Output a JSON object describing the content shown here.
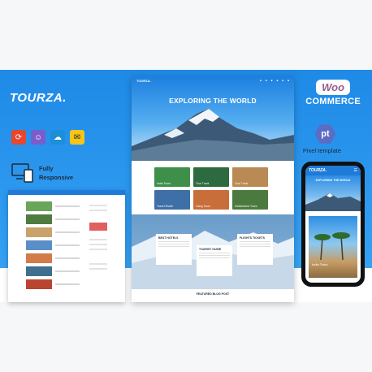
{
  "brand": {
    "name": "TOURZA."
  },
  "features": {
    "responsive_line1": "Fully",
    "responsive_line2": "Responsive"
  },
  "woo": {
    "badge": "Woo",
    "sub": "COMMERCE"
  },
  "pixel_template": {
    "abbr": "pt",
    "label": "Pixel template"
  },
  "main_mockup": {
    "logo": "TOURZA.",
    "hero_title": "EXPLORING THE WORLD",
    "tours": [
      {
        "label": "India Tours",
        "color": "#3d8f4a"
      },
      {
        "label": "Tour Track",
        "color": "#2d6a3f"
      },
      {
        "label": "Tour Track",
        "color": "#b98a54"
      },
      {
        "label": "Travel Route",
        "color": "#3e6fa6"
      },
      {
        "label": "Gang Tours",
        "color": "#c86e3a"
      },
      {
        "label": "Switzerland Tours",
        "color": "#4b7a3f"
      }
    ],
    "cards": [
      {
        "title": "BEST HOTELS"
      },
      {
        "title": "TOURIST GUIDE"
      },
      {
        "title": "FLIGHTS TICKETS"
      }
    ],
    "featured_label": "FEATURED BLOG POST"
  },
  "phone": {
    "logo": "TOURZA.",
    "title": "EXPLORING THE WORLD",
    "card_label": "India Tours"
  },
  "colors": {
    "accent": "#1f8ae6",
    "woo": "#9b5c8f"
  }
}
